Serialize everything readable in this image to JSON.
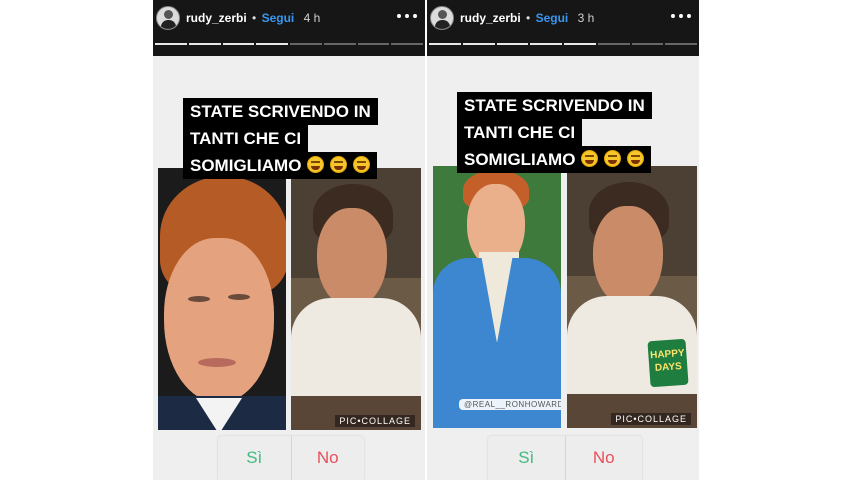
{
  "stories": [
    {
      "username": "rudy_zerbi",
      "follow_label": "Segui",
      "separator": "•",
      "time": "4 h",
      "progress": {
        "total": 8,
        "watched": 4
      },
      "caption_lines": [
        "STATE SCRIVENDO IN",
        "TANTI CHE CI",
        "SOMIGLIAMO"
      ],
      "emoji_count": 3,
      "watermark": "PIC•COLLAGE",
      "poll": {
        "yes": "Sì",
        "no": "No"
      }
    },
    {
      "username": "rudy_zerbi",
      "follow_label": "Segui",
      "separator": "•",
      "time": "3 h",
      "progress": {
        "total": 8,
        "watched": 5
      },
      "caption_lines": [
        "STATE SCRIVENDO IN",
        "TANTI CHE CI",
        "SOMIGLIAMO"
      ],
      "emoji_count": 3,
      "watermark": "PIC•COLLAGE",
      "mention": "@REAL__RONHOWARD",
      "sticker_lines": [
        "HAPPY",
        "DAYS"
      ],
      "poll": {
        "yes": "Sì",
        "no": "No"
      }
    }
  ],
  "colors": {
    "follow": "#3897f0",
    "poll_yes": "#43b97f",
    "poll_no": "#e8505b",
    "header_bg": "#161616"
  },
  "icons": {
    "more": "more-horizontal-icon",
    "emoji": "laughing-tears-emoji-icon"
  }
}
